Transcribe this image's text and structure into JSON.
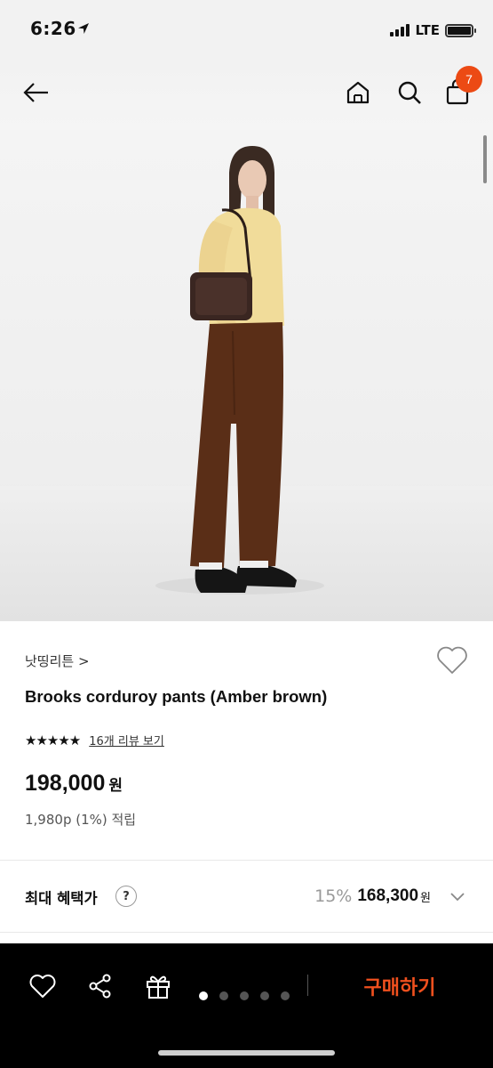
{
  "status_bar": {
    "time": "6:26",
    "network": "LTE"
  },
  "nav": {
    "cart_count": "7"
  },
  "product": {
    "brand": "낫띵리튼 >",
    "name": "Brooks corduroy pants (Amber brown)",
    "stars": "★★★★★",
    "review_link": "16개 리뷰 보기",
    "price": "198,000",
    "price_unit": "원",
    "points": "1,980p (1%) 적립"
  },
  "benefit": {
    "label": "최대 혜택가",
    "help": "?",
    "discount": "15%",
    "price": "168,300",
    "unit": "원"
  },
  "bottom_bar": {
    "buy_label": "구매하기"
  },
  "colors": {
    "accent": "#f0501e",
    "badge": "#ec4a14"
  },
  "icons": [
    "back-icon",
    "home-icon",
    "search-icon",
    "shopping-bag-icon",
    "heart-icon",
    "share-icon",
    "gift-icon",
    "chevron-down-icon",
    "location-arrow-icon"
  ]
}
